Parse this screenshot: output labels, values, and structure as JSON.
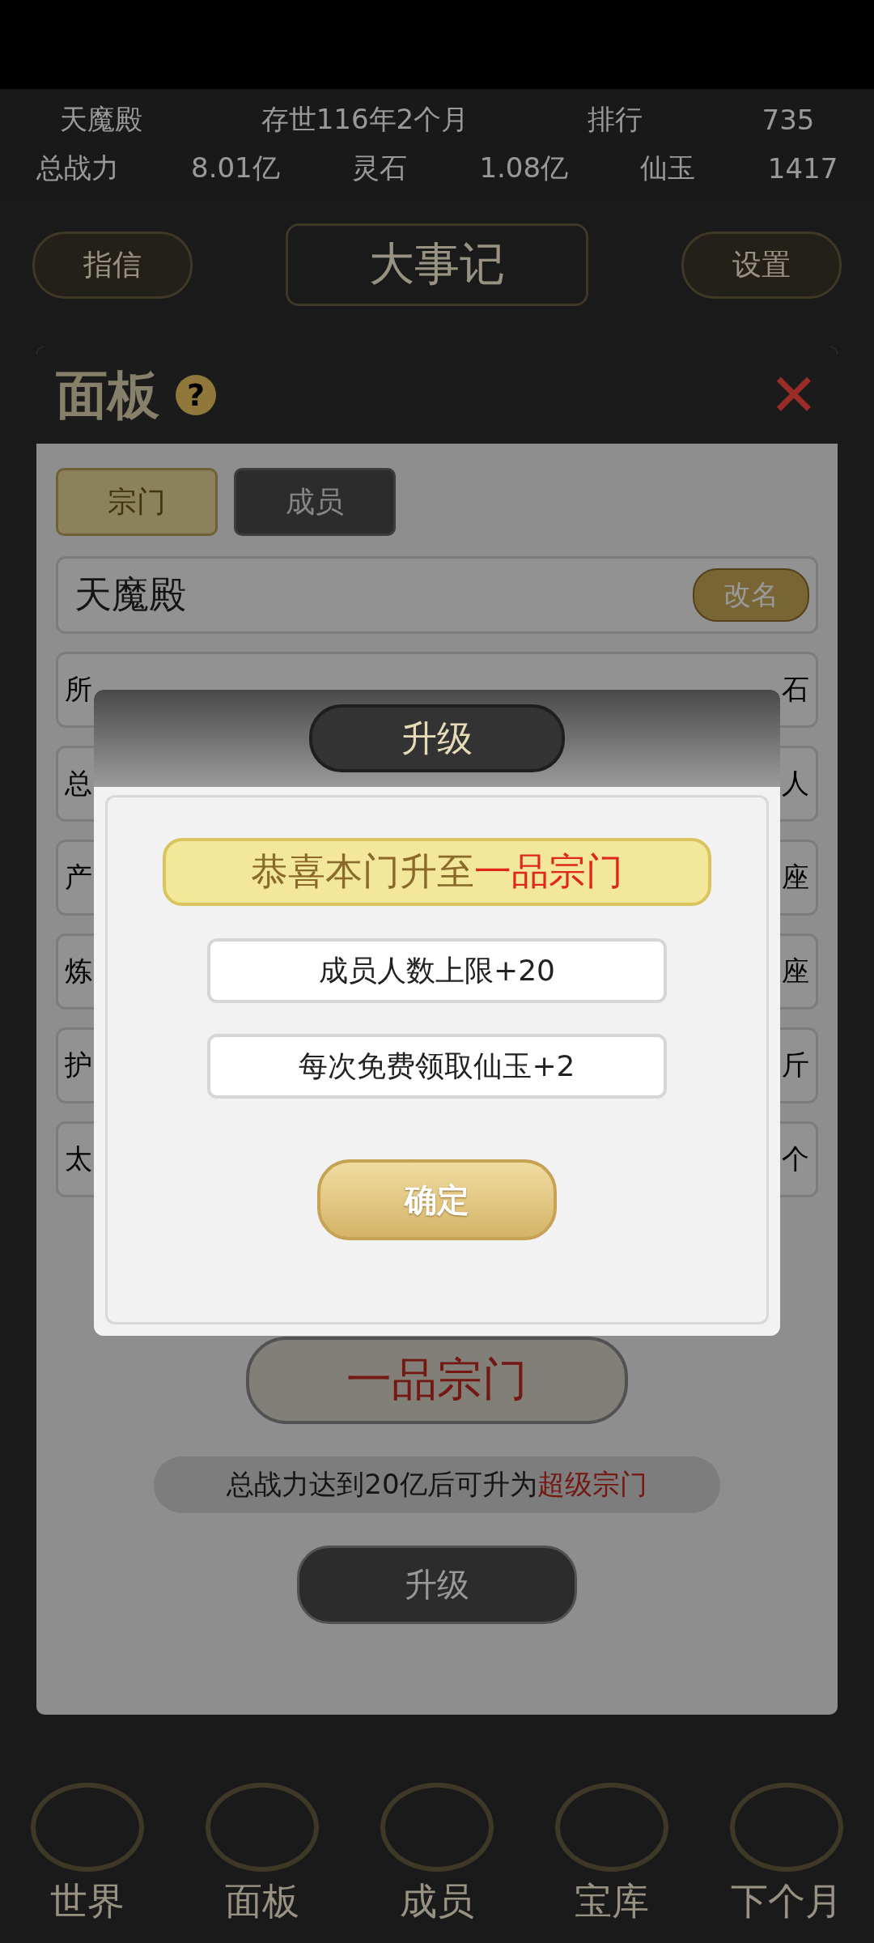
{
  "top_info": {
    "sect_name": "天魔殿",
    "age": "存世116年2个月",
    "rank_label": "排行",
    "rank": "735",
    "power_label": "总战力",
    "power": "8.01亿",
    "stone_label": "灵石",
    "stone": "1.08亿",
    "jade_label": "仙玉",
    "jade": "1417"
  },
  "top_buttons": [
    {
      "label": "指信",
      "kind": "side"
    },
    {
      "label": "大事记",
      "kind": "main"
    },
    {
      "label": "设置",
      "kind": "side"
    }
  ],
  "panel": {
    "title": "面板",
    "help": "?",
    "close": "✕",
    "tabs": [
      {
        "label": "宗门",
        "selected": true
      },
      {
        "label": "成员",
        "selected": false
      }
    ],
    "name": "天魔殿",
    "rename": "改名",
    "rows": [
      {
        "label": "所",
        "value": "石"
      },
      {
        "label": "总",
        "value": "人"
      },
      {
        "label": "产",
        "value": "座"
      },
      {
        "label": "炼",
        "value": "座"
      },
      {
        "label": "护",
        "value": "斤"
      },
      {
        "label": "太",
        "value": "个"
      }
    ],
    "rank_badge": "一品宗门",
    "requirement": "总战力达到20亿后可升为",
    "requirement_target": "超级宗门",
    "upgrade": "升级"
  },
  "bottom_nav": [
    {
      "label": "世界"
    },
    {
      "label": "面板"
    },
    {
      "label": "成员"
    },
    {
      "label": "宝库"
    },
    {
      "label": "下个月"
    }
  ],
  "dialog": {
    "title": "升级",
    "congrats": "恭喜本门升至",
    "congrats_target": "一品宗门",
    "rewards": [
      "成员人数上限+20",
      "每次免费领取仙玉+2"
    ],
    "confirm": "确定"
  }
}
